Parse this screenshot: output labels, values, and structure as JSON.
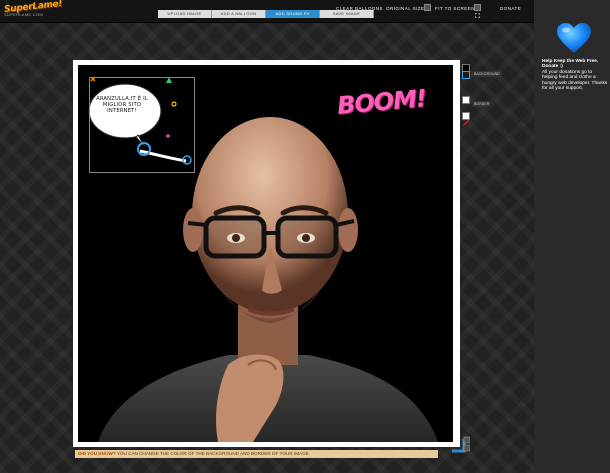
{
  "app": {
    "logo_text": "SuperLame!",
    "logo_sub": "SUPERLAME.COM"
  },
  "topbar": {
    "clear_balloons": "CLEAR BALLOONS",
    "original_size": "ORIGINAL SIZE",
    "fit_to_screen": "FIT TO SCREEN",
    "donate": "DONATE"
  },
  "tabs": [
    {
      "label": "UPLOAD IMAGE",
      "active": false
    },
    {
      "label": "ADD A BALLOON",
      "active": false
    },
    {
      "label": "ADD SOUND FX",
      "active": true
    },
    {
      "label": "SAVE IMAGE",
      "active": false
    }
  ],
  "sidebar": {
    "donate_title": "Help Keep the Web Free. Donate :)",
    "donate_body": "All your donations go to helping feed and clothe a hungry web developer. Thanks for all your support."
  },
  "canvas": {
    "balloon_text": "ARANZULLA.IT È IL MIGLIOR SITO INTERNET!",
    "sound_fx_text": "BOOM!"
  },
  "colors": {
    "accent_orange": "#f7a21b",
    "active_tab": "#2d8fd0",
    "boom_pink": "#ff5fb8",
    "heart_blue": "#1e90ff",
    "handle_blue": "#3aa0e8"
  },
  "options": {
    "background_label": "BACKGROUND",
    "border_label": "BORDER"
  },
  "info_bar": {
    "prefix": "DID YOU KNOW?",
    "text": "YOU CAN CHANGE THE COLOR OF THE BACKGROUND AND BORDER OF YOUR IMAGE."
  },
  "icons": [
    "heart-icon",
    "resize-handle-icon",
    "fit-screen-icon",
    "original-size-icon",
    "close-icon",
    "rotate-icon"
  ]
}
